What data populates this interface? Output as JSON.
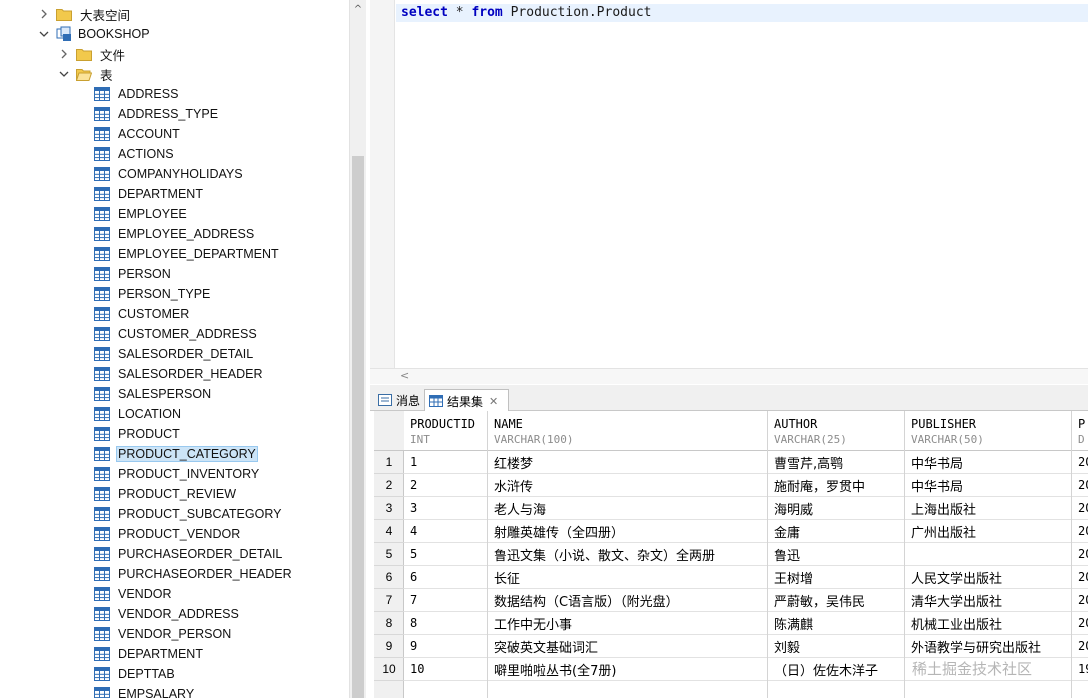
{
  "tree": {
    "items": [
      {
        "label": "大表空间",
        "kind": "folder",
        "expanded": false,
        "level": 1
      },
      {
        "label": "BOOKSHOP",
        "kind": "db",
        "expanded": true,
        "level": 1
      },
      {
        "label": "文件",
        "kind": "folder",
        "expanded": false,
        "level": 2
      },
      {
        "label": "表",
        "kind": "folder",
        "expanded": true,
        "level": 2
      },
      {
        "label": "ADDRESS",
        "kind": "table"
      },
      {
        "label": "ADDRESS_TYPE",
        "kind": "table"
      },
      {
        "label": "ACCOUNT",
        "kind": "table"
      },
      {
        "label": "ACTIONS",
        "kind": "table"
      },
      {
        "label": "COMPANYHOLIDAYS",
        "kind": "table"
      },
      {
        "label": "DEPARTMENT",
        "kind": "table"
      },
      {
        "label": "EMPLOYEE",
        "kind": "table"
      },
      {
        "label": "EMPLOYEE_ADDRESS",
        "kind": "table"
      },
      {
        "label": "EMPLOYEE_DEPARTMENT",
        "kind": "table"
      },
      {
        "label": "PERSON",
        "kind": "table"
      },
      {
        "label": "PERSON_TYPE",
        "kind": "table"
      },
      {
        "label": "CUSTOMER",
        "kind": "table"
      },
      {
        "label": "CUSTOMER_ADDRESS",
        "kind": "table"
      },
      {
        "label": "SALESORDER_DETAIL",
        "kind": "table"
      },
      {
        "label": "SALESORDER_HEADER",
        "kind": "table"
      },
      {
        "label": "SALESPERSON",
        "kind": "table"
      },
      {
        "label": "LOCATION",
        "kind": "table"
      },
      {
        "label": "PRODUCT",
        "kind": "table"
      },
      {
        "label": "PRODUCT_CATEGORY",
        "kind": "table",
        "selected": true
      },
      {
        "label": "PRODUCT_INVENTORY",
        "kind": "table"
      },
      {
        "label": "PRODUCT_REVIEW",
        "kind": "table"
      },
      {
        "label": "PRODUCT_SUBCATEGORY",
        "kind": "table"
      },
      {
        "label": "PRODUCT_VENDOR",
        "kind": "table"
      },
      {
        "label": "PURCHASEORDER_DETAIL",
        "kind": "table"
      },
      {
        "label": "PURCHASEORDER_HEADER",
        "kind": "table"
      },
      {
        "label": "VENDOR",
        "kind": "table"
      },
      {
        "label": "VENDOR_ADDRESS",
        "kind": "table"
      },
      {
        "label": "VENDOR_PERSON",
        "kind": "table"
      },
      {
        "label": "DEPARTMENT",
        "kind": "table"
      },
      {
        "label": "DEPTTAB",
        "kind": "table"
      },
      {
        "label": "EMPSALARY",
        "kind": "table"
      }
    ]
  },
  "editor": {
    "tokens": [
      {
        "text": "select",
        "type": "kw"
      },
      {
        "text": " * ",
        "type": "id"
      },
      {
        "text": "from",
        "type": "kw"
      },
      {
        "text": " Production.Product",
        "type": "id"
      }
    ]
  },
  "results": {
    "tabs": [
      {
        "label": "消息",
        "active": false
      },
      {
        "label": "结果集",
        "active": true
      }
    ],
    "columns": [
      {
        "name": "PRODUCTID",
        "type": "INT"
      },
      {
        "name": "NAME",
        "type": "VARCHAR(100)"
      },
      {
        "name": "AUTHOR",
        "type": "VARCHAR(25)"
      },
      {
        "name": "PUBLISHER",
        "type": "VARCHAR(50)"
      },
      {
        "name": "P",
        "type": "D"
      }
    ],
    "rows": [
      [
        "1",
        "红楼梦",
        "曹雪芹,高鹗",
        "中华书局",
        "20"
      ],
      [
        "2",
        "水浒传",
        "施耐庵，罗贯中",
        "中华书局",
        "20"
      ],
      [
        "3",
        "老人与海",
        "海明威",
        "上海出版社",
        "20"
      ],
      [
        "4",
        "射雕英雄传（全四册）",
        "金庸",
        "广州出版社",
        "20"
      ],
      [
        "5",
        "鲁迅文集（小说、散文、杂文）全两册",
        "鲁迅",
        "",
        "20"
      ],
      [
        "6",
        "长征",
        "王树增",
        "人民文学出版社",
        "20"
      ],
      [
        "7",
        "数据结构（C语言版）（附光盘）",
        "严蔚敏，吴伟民",
        "清华大学出版社",
        "20"
      ],
      [
        "8",
        "工作中无小事",
        "陈满麒",
        "机械工业出版社",
        "20"
      ],
      [
        "9",
        "突破英文基础词汇",
        "刘毅",
        "外语教学与研究出版社",
        "20"
      ],
      [
        "10",
        "噼里啪啦丛书(全7册)",
        "（日）佐佐木洋子",
        "",
        "19"
      ]
    ]
  },
  "watermark": "稀土掘金技术社区",
  "colors": {
    "keyword": "#0000c0",
    "selection": "#cce4f7",
    "current_line": "#e8f2fe"
  }
}
